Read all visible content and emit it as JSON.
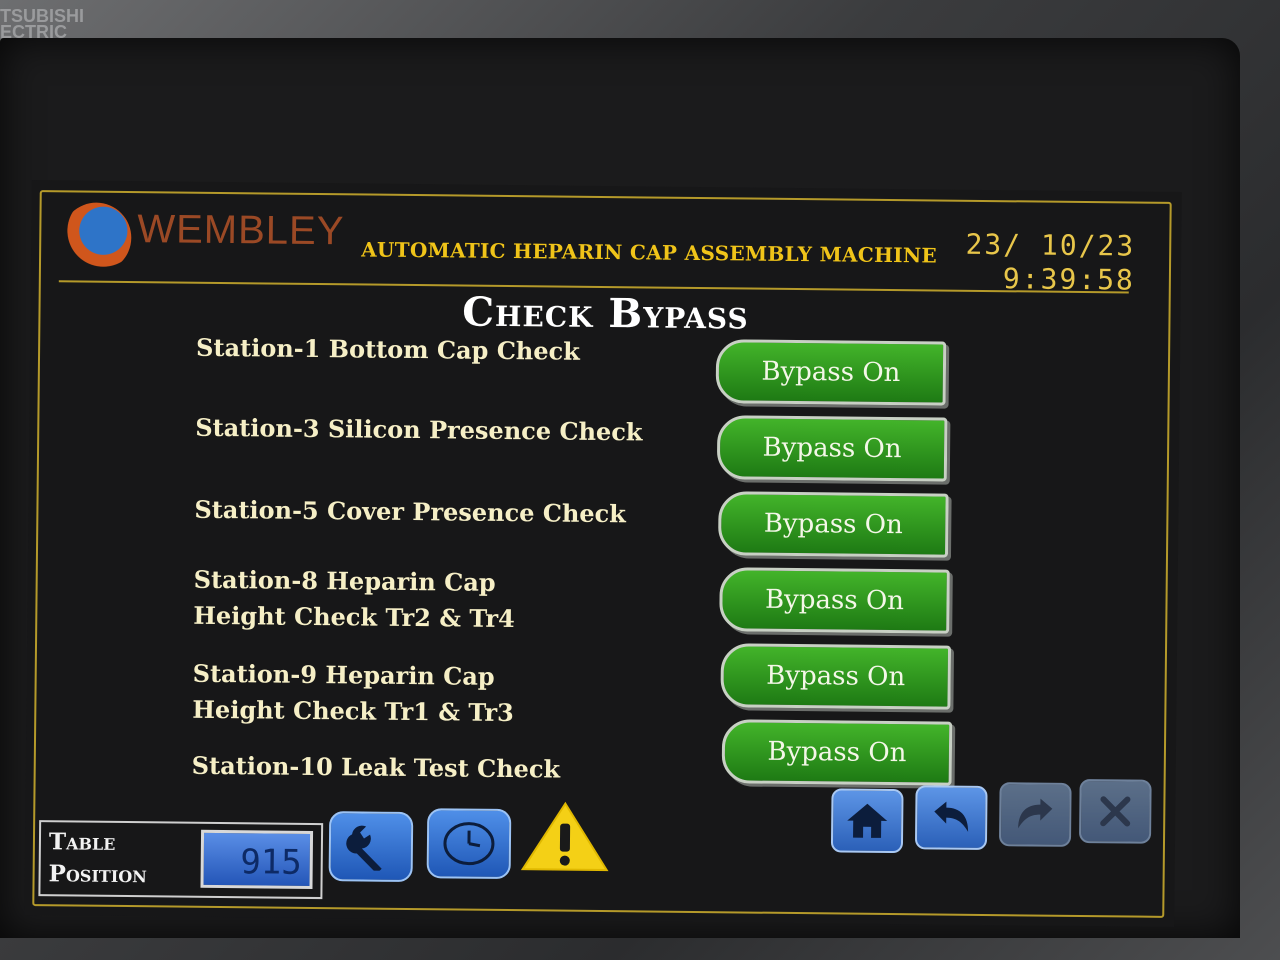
{
  "device_brand": "TSUBISHI\nECTRIC",
  "header": {
    "logo_text": "WEMBLEY",
    "machine_title": "AUTOMATIC HEPARIN CAP ASSEMBLY MACHINE",
    "date": "23/ 10/23",
    "time": "9:39:58"
  },
  "page_title": "Check Bypass",
  "stations": [
    {
      "label": "Station-1 Bottom Cap Check",
      "button": "Bypass On"
    },
    {
      "label": "Station-3 Silicon Presence Check",
      "button": "Bypass On"
    },
    {
      "label": "Station-5 Cover Presence Check",
      "button": "Bypass On"
    },
    {
      "label": "Station-8 Heparin Cap\nHeight Check Tr2 & Tr4",
      "button": "Bypass On"
    },
    {
      "label": "Station-9 Heparin Cap\nHeight Check Tr1 & Tr3",
      "button": "Bypass On"
    },
    {
      "label": "Station-10 Leak Test Check",
      "button": "Bypass On"
    }
  ],
  "table_position": {
    "label": "Table\nPosition",
    "value": "915"
  },
  "icons": {
    "settings": "wrench-icon",
    "clock": "clock-icon",
    "warning": "warning-icon",
    "home": "home-icon",
    "back": "back-arrow-icon",
    "forward": "forward-arrow-icon",
    "close": "close-icon"
  },
  "colors": {
    "accent_yellow": "#f0c419",
    "bypass_green": "#2e9a1e",
    "button_blue": "#2f6cc8"
  }
}
